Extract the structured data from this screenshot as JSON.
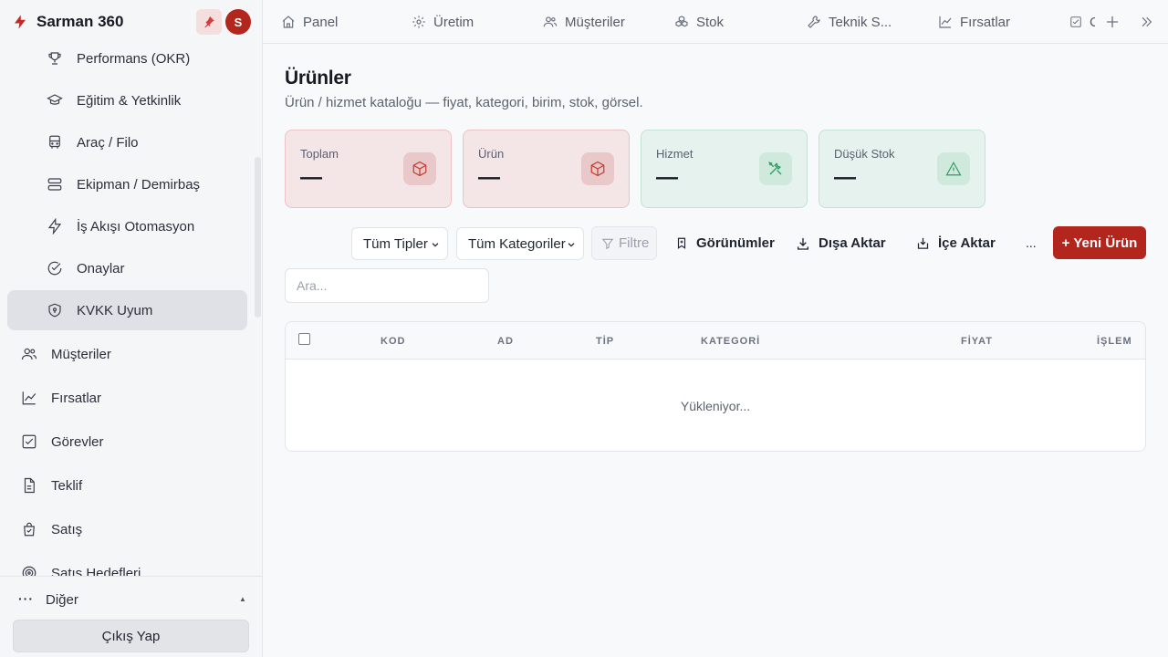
{
  "brand": {
    "name": "Sarman 360",
    "avatar_initial": "S"
  },
  "sidebar": {
    "sub_items": [
      {
        "label": "Performans (OKR)",
        "icon": "trophy-icon"
      },
      {
        "label": "Eğitim & Yetkinlik",
        "icon": "graduation-cap-icon"
      },
      {
        "label": "Araç / Filo",
        "icon": "bus-icon"
      },
      {
        "label": "Ekipman / Demirbaş",
        "icon": "server-icon"
      },
      {
        "label": "İş Akışı Otomasyon",
        "icon": "lightning-icon"
      },
      {
        "label": "Onaylar",
        "icon": "check-circle-icon"
      },
      {
        "label": "KVKK Uyum",
        "icon": "shield-icon",
        "active": true
      }
    ],
    "main_items": [
      {
        "label": "Müşteriler",
        "icon": "users-icon"
      },
      {
        "label": "Fırsatlar",
        "icon": "trend-chart-icon"
      },
      {
        "label": "Görevler",
        "icon": "checkbox-icon"
      },
      {
        "label": "Teklif",
        "icon": "document-icon"
      },
      {
        "label": "Satış",
        "icon": "shopping-bag-icon"
      },
      {
        "label": "Satış Hedefleri",
        "icon": "target-icon"
      }
    ],
    "other_label": "Diğer",
    "logout_label": "Çıkış Yap"
  },
  "topbar": {
    "tabs": [
      {
        "label": "Panel",
        "icon": "home-icon"
      },
      {
        "label": "Üretim",
        "icon": "gear-icon"
      },
      {
        "label": "Müşteriler",
        "icon": "users-icon"
      },
      {
        "label": "Stok",
        "icon": "boxes-icon"
      },
      {
        "label": "Teknik S...",
        "icon": "wrench-icon"
      },
      {
        "label": "Fırsatlar",
        "icon": "trend-chart-icon"
      },
      {
        "label": "C",
        "icon": "checkbox-icon"
      }
    ]
  },
  "page": {
    "title": "Ürünler",
    "subtitle": "Ürün / hizmet kataloğu — fiyat, kategori, birim, stok, görsel."
  },
  "stats": [
    {
      "label": "Toplam",
      "value": "—",
      "tone": "red",
      "icon": "box-icon"
    },
    {
      "label": "Ürün",
      "value": "—",
      "tone": "red",
      "icon": "box-icon"
    },
    {
      "label": "Hizmet",
      "value": "—",
      "tone": "green",
      "icon": "tools-icon"
    },
    {
      "label": "Düşük Stok",
      "value": "—",
      "tone": "green",
      "icon": "warning-icon"
    }
  ],
  "toolbar": {
    "type_select": "Tüm Tipler",
    "category_select": "Tüm Kategoriler",
    "filter_label": "Filtre",
    "views_label": "Görünümler",
    "export_label": "Dışa Aktar",
    "import_label": "İçe Aktar",
    "more_label": "...",
    "new_label": "+ Yeni Ürün"
  },
  "search": {
    "placeholder": "Ara..."
  },
  "table": {
    "columns": [
      "KOD",
      "AD",
      "TİP",
      "KATEGORİ",
      "FİYAT",
      "İŞLEM"
    ],
    "loading_text": "Yükleniyor..."
  },
  "colors": {
    "accent": "#b3261e",
    "stat_red_bg": "#f4e6e7",
    "stat_green_bg": "#e6f2ed"
  }
}
